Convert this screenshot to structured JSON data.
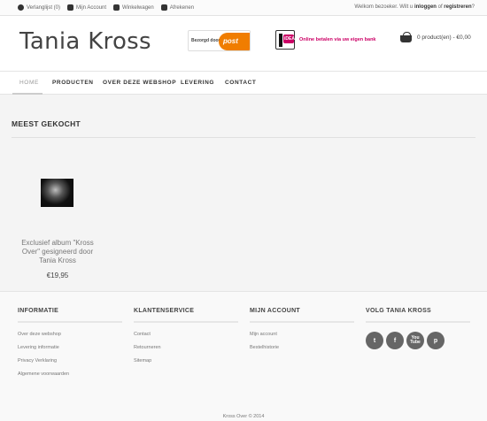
{
  "topbar": {
    "wishlist": "Verlanglijst (0)",
    "account": "Mijn Account",
    "cart": "Winkelwagen",
    "checkout": "Afrekenen",
    "welcome_prefix": "Welkom bezoeker. Wilt u ",
    "login": "inloggen",
    "or": " of ",
    "register": "registreren",
    "welcome_suffix": "?"
  },
  "header": {
    "logo": "Tania Kross",
    "postnl_text": "Bezorgd door",
    "postnl_logo": "post",
    "ideal_badge": "iDEAL",
    "ideal_tagline": "Online betalen via uw eigen bank",
    "cart_summary": "0 product(en) - €0,00"
  },
  "nav": {
    "items": [
      "Home",
      "Producten",
      "Over deze webshop",
      "Levering",
      "Contact"
    ]
  },
  "main": {
    "section_title": "Meest gekocht",
    "product": {
      "name": "Exclusief album \"Kross Over\" gesigneerd door Tania Kross",
      "price": "€19,95"
    }
  },
  "footer": {
    "col1": {
      "title": "Informatie",
      "links": [
        "Over deze webshop",
        "Levering informatie",
        "Privacy Verklaring",
        "Algemene voorwaarden"
      ]
    },
    "col2": {
      "title": "Klantenservice",
      "links": [
        "Contact",
        "Retourneren",
        "Sitemap"
      ]
    },
    "col3": {
      "title": "Mijn account",
      "links": [
        "Mijn account",
        "Bestelhistorie"
      ]
    },
    "col4": {
      "title": "Volg Tania Kross",
      "social": [
        "t",
        "f",
        "You Tube",
        "p"
      ]
    },
    "copyright": "Kross Over © 2014"
  }
}
